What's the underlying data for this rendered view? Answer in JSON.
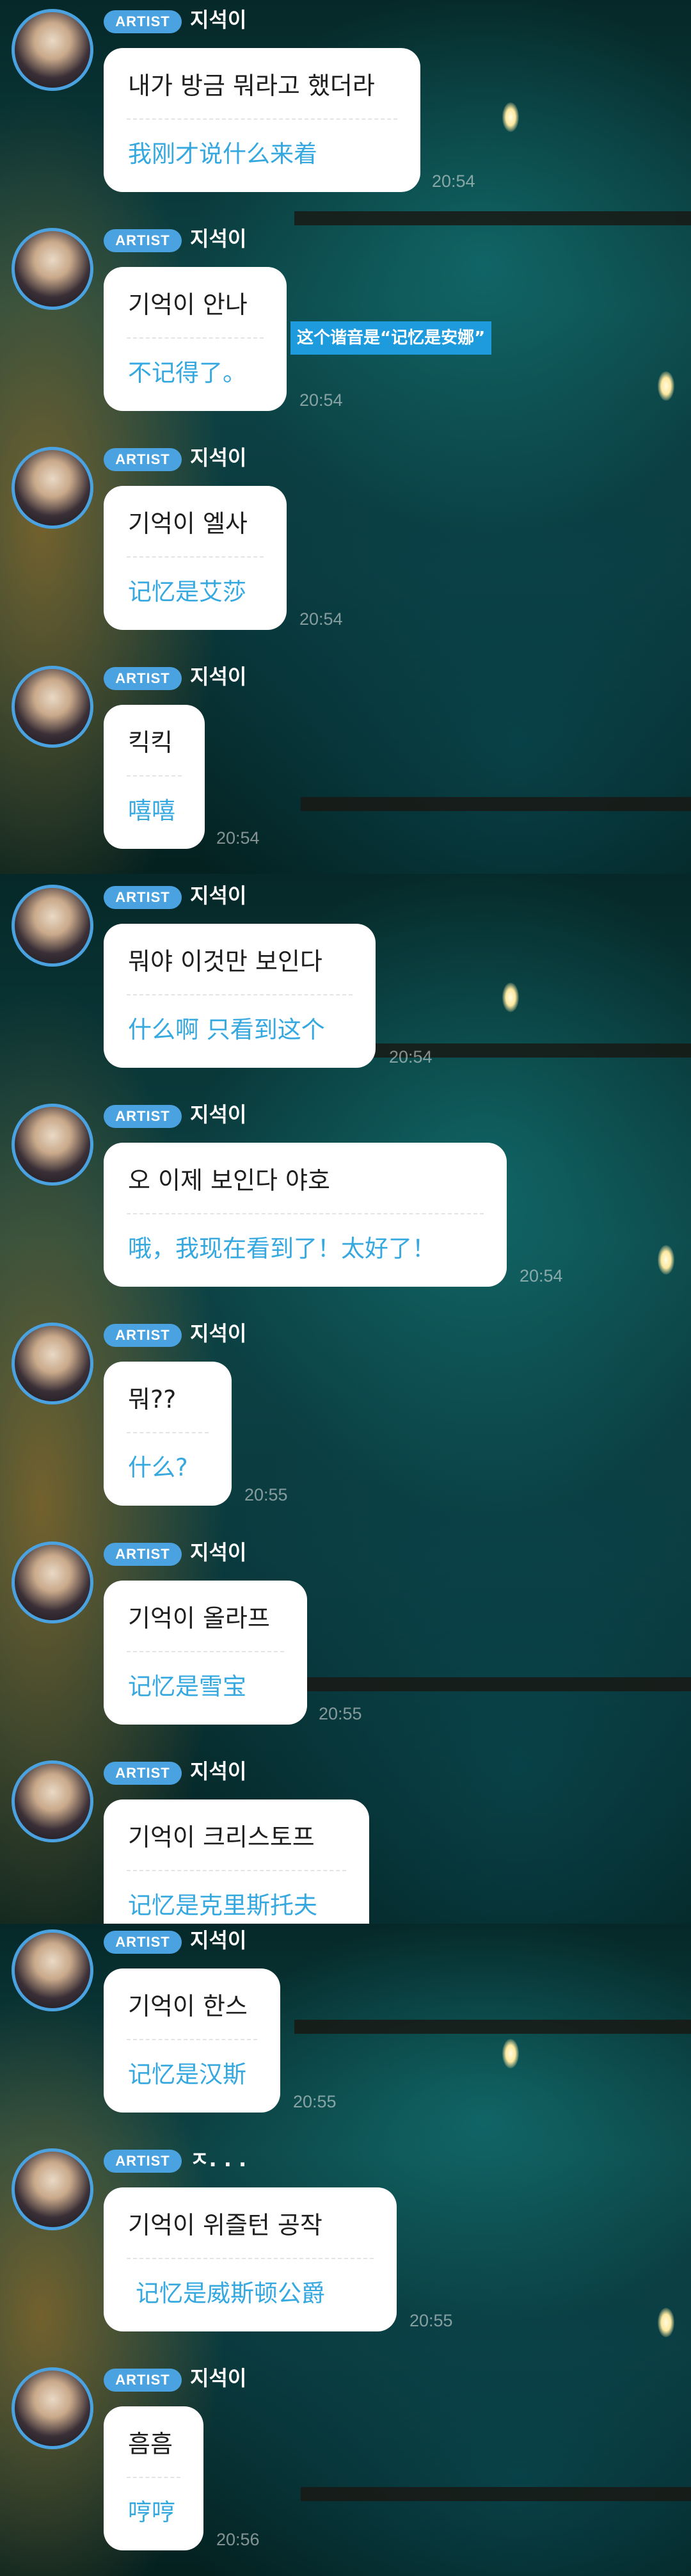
{
  "badge_label": "ARTIST",
  "colors": {
    "badge": "#4aa3e0",
    "translation": "#35a8e0",
    "bubble": "#ffffff",
    "annotation_tag": "#1e9bdc"
  },
  "annotation": "这个谐音是“记忆是安娜”",
  "messages": [
    {
      "user": "지석이",
      "korean": "내가 방금 뭐라고 했더라",
      "chinese": "我刚才说什么来着",
      "time": "20:54"
    },
    {
      "user": "지석이",
      "korean": "기억이 안나",
      "chinese": "不记得了。",
      "time": "20:54"
    },
    {
      "user": "지석이",
      "korean": "기억이 엘사",
      "chinese": "记忆是艾莎",
      "time": "20:54"
    },
    {
      "user": "지석이",
      "korean": "킥킥",
      "chinese": "嘻嘻",
      "time": "20:54"
    },
    {
      "user": "지석이",
      "korean": "뭐야 이것만 보인다",
      "chinese": "什么啊 只看到这个",
      "time": "20:54"
    },
    {
      "user": "지석이",
      "korean": "오 이제 보인다 야호",
      "chinese": "哦，我现在看到了！太好了！",
      "time": "20:54"
    },
    {
      "user": "지석이",
      "korean": "뭐??",
      "chinese": "什么?",
      "time": "20:55"
    },
    {
      "user": "지석이",
      "korean": "기억이 올라프",
      "chinese": "记忆是雪宝",
      "time": "20:55"
    },
    {
      "user": "지석이",
      "korean": "기억이 크리스토프",
      "chinese": "记忆是克里斯托夫",
      "time": ""
    },
    {
      "user": "지석이",
      "korean": "기억이 한스",
      "chinese": "记忆是汉斯",
      "time": "20:55"
    },
    {
      "user": "ㅈ. . .",
      "korean": "기억이 위즐턴 공작",
      "chinese": "记忆是威斯顿公爵",
      "time": "20:55"
    },
    {
      "user": "지석이",
      "korean": "흠흠",
      "chinese": "哼哼",
      "time": "20:56"
    }
  ]
}
